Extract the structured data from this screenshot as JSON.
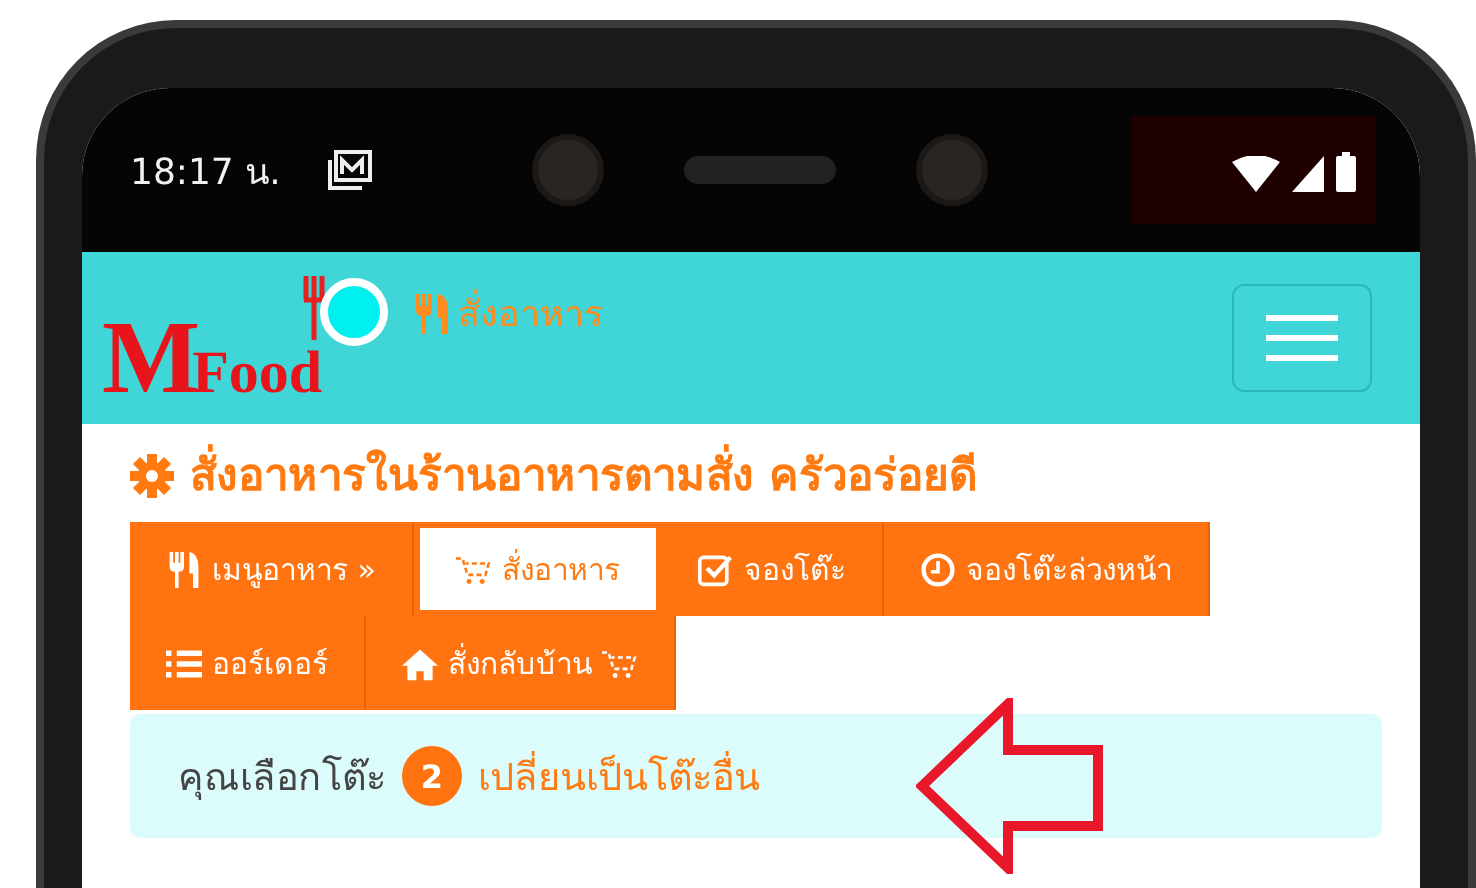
{
  "status_bar": {
    "time": "18:17 น."
  },
  "navbar": {
    "logo": {
      "big": "M",
      "small": "Food"
    },
    "brand": "สั่งอาหาร"
  },
  "heading": "สั่งอาหารในร้านอาหารตามสั่ง ครัวอร่อยดี",
  "tabs": [
    {
      "label": "เมนูอาหาร »",
      "selected": false
    },
    {
      "label": "สั่งอาหาร",
      "selected": true
    },
    {
      "label": "จองโต๊ะ",
      "selected": false
    },
    {
      "label": "จองโต๊ะล่วงหน้า",
      "selected": false
    },
    {
      "label": "ออร์เดอร์",
      "selected": false
    },
    {
      "label": "สั่งกลับบ้าน",
      "selected": false
    }
  ],
  "alert": {
    "text": "คุณเลือกโต๊ะ",
    "badge": "2",
    "link": "เปลี่ยนเป็นโต๊ะอื่น"
  }
}
